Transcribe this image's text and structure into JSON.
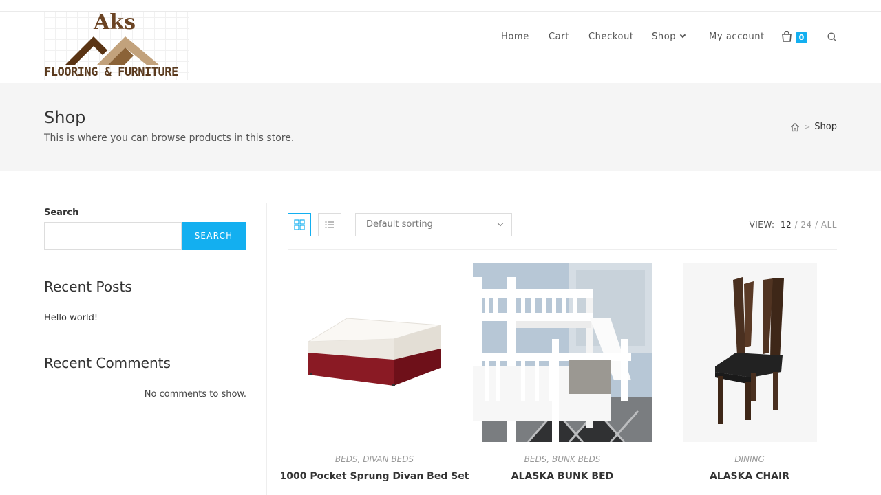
{
  "brand": {
    "logo_top": "Aks",
    "logo_bottom": "FLOORING & FURNITURE"
  },
  "nav": {
    "items": [
      "Home",
      "Cart",
      "Checkout",
      "Shop",
      "My account"
    ],
    "cart_count": "0"
  },
  "page": {
    "title": "Shop",
    "subtitle": "This is where you can browse products in this store.",
    "breadcrumb_current": "Shop"
  },
  "sidebar": {
    "search_label": "Search",
    "search_value": "",
    "search_button": "SEARCH",
    "recent_posts_heading": "Recent Posts",
    "recent_posts": [
      "Hello world!"
    ],
    "recent_comments_heading": "Recent Comments",
    "no_comments": "No comments to show."
  },
  "toolbar": {
    "sort_selected": "Default sorting",
    "view_label": "VIEW:",
    "view_current": "12",
    "view_options": [
      "24",
      "ALL"
    ]
  },
  "products": [
    {
      "cat1": "BEDS",
      "cat2": "DIVAN BEDS",
      "name": "1000 Pocket Sprung Divan Bed Set"
    },
    {
      "cat1": "BEDS",
      "cat2": "BUNK BEDS",
      "name": "ALASKA BUNK BED"
    },
    {
      "cat1": "DINING",
      "cat2": "",
      "name": "ALASKA CHAIR"
    }
  ],
  "colors": {
    "accent": "#13aff0",
    "brand_brown": "#6b4424"
  }
}
